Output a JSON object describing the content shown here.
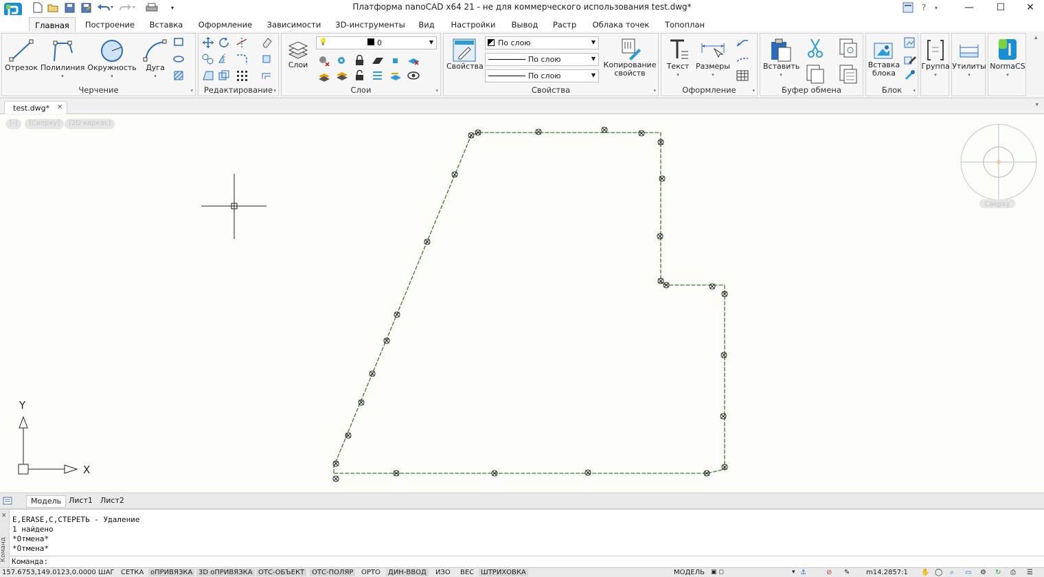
{
  "window": {
    "title": "Платформа nanoCAD x64 21 - не для коммерческого использования test.dwg*",
    "controls": {
      "minimize": "—",
      "maximize": "☐",
      "close": "✕"
    }
  },
  "quick_access": [
    "new-file-icon",
    "open-folder-icon",
    "save-icon",
    "save-as-icon",
    "undo-icon",
    "redo-icon",
    "print-icon"
  ],
  "ribbon_tabs": [
    "Главная",
    "Построение",
    "Вставка",
    "Оформление",
    "Зависимости",
    "3D-инструменты",
    "Вид",
    "Настройки",
    "Вывод",
    "Растр",
    "Облака точек",
    "Топоплан"
  ],
  "active_tab": "Главная",
  "panels": {
    "drawing": {
      "title": "Черчение",
      "buttons": [
        "Отрезок",
        "Полилиния",
        "Окружность",
        "Дуга"
      ]
    },
    "edit": {
      "title": "Редактирование"
    },
    "layers": {
      "title": "Слои",
      "button": "Слои",
      "current_layer": "0"
    },
    "properties": {
      "title": "Свойства",
      "button": "Свойства",
      "color": "По слою",
      "linetype": "По слою",
      "lineweight": "По слою",
      "copy_button": "Копирование свойств"
    },
    "annotation": {
      "title": "Оформление",
      "buttons": [
        "Текст",
        "Размеры"
      ]
    },
    "clipboard": {
      "title": "Буфер обмена",
      "button": "Вставить"
    },
    "block": {
      "title": "Блок",
      "button": "Вставка блока"
    },
    "group": {
      "button": "Группа"
    },
    "utilities": {
      "button": "Утилиты"
    },
    "normacs": {
      "button": "NormaCS"
    }
  },
  "document_tab": {
    "name": "test.dwg*",
    "close": "✕"
  },
  "viewport_controls": [
    "[-]",
    "[Сверху]",
    "[2D каркас]"
  ],
  "viewcube_label": "Сверху",
  "ucs": {
    "x": "X",
    "y": "Y"
  },
  "layout_tabs": [
    "Модель",
    "Лист1",
    "Лист2"
  ],
  "active_layout": "Модель",
  "command_history": [
    "E,ERASE,С,СТЕРЕТЬ - Удаление",
    "1 найдено",
    "*Отмена*",
    "*Отмена*"
  ],
  "command_side_label": "Команд",
  "command_prompt": "Команда:",
  "status": {
    "coords": "157.6753,149.0123,0.0000",
    "toggles": [
      {
        "label": "ШАГ",
        "on": false
      },
      {
        "label": "СЕТКА",
        "on": false
      },
      {
        "label": "оПРИВЯЗКА",
        "on": true
      },
      {
        "label": "3D оПРИВЯЗКА",
        "on": true
      },
      {
        "label": "ОТС-ОБЪЕКТ",
        "on": true
      },
      {
        "label": "ОТС-ПОЛЯР",
        "on": true
      },
      {
        "label": "ОРТО",
        "on": false
      },
      {
        "label": "ДИН-ВВОД",
        "on": true
      },
      {
        "label": "ИЗО",
        "on": false
      },
      {
        "label": "ВЕС",
        "on": false
      },
      {
        "label": "ШТРИХОВКА",
        "on": true
      }
    ],
    "mode": "МОДЕЛЬ",
    "scale": "m14.2857:1"
  },
  "colors": {
    "polyline": "#3a7d2c",
    "accent_blue": "#1e6fc4",
    "canvas_bg": "#fdfdfa"
  }
}
